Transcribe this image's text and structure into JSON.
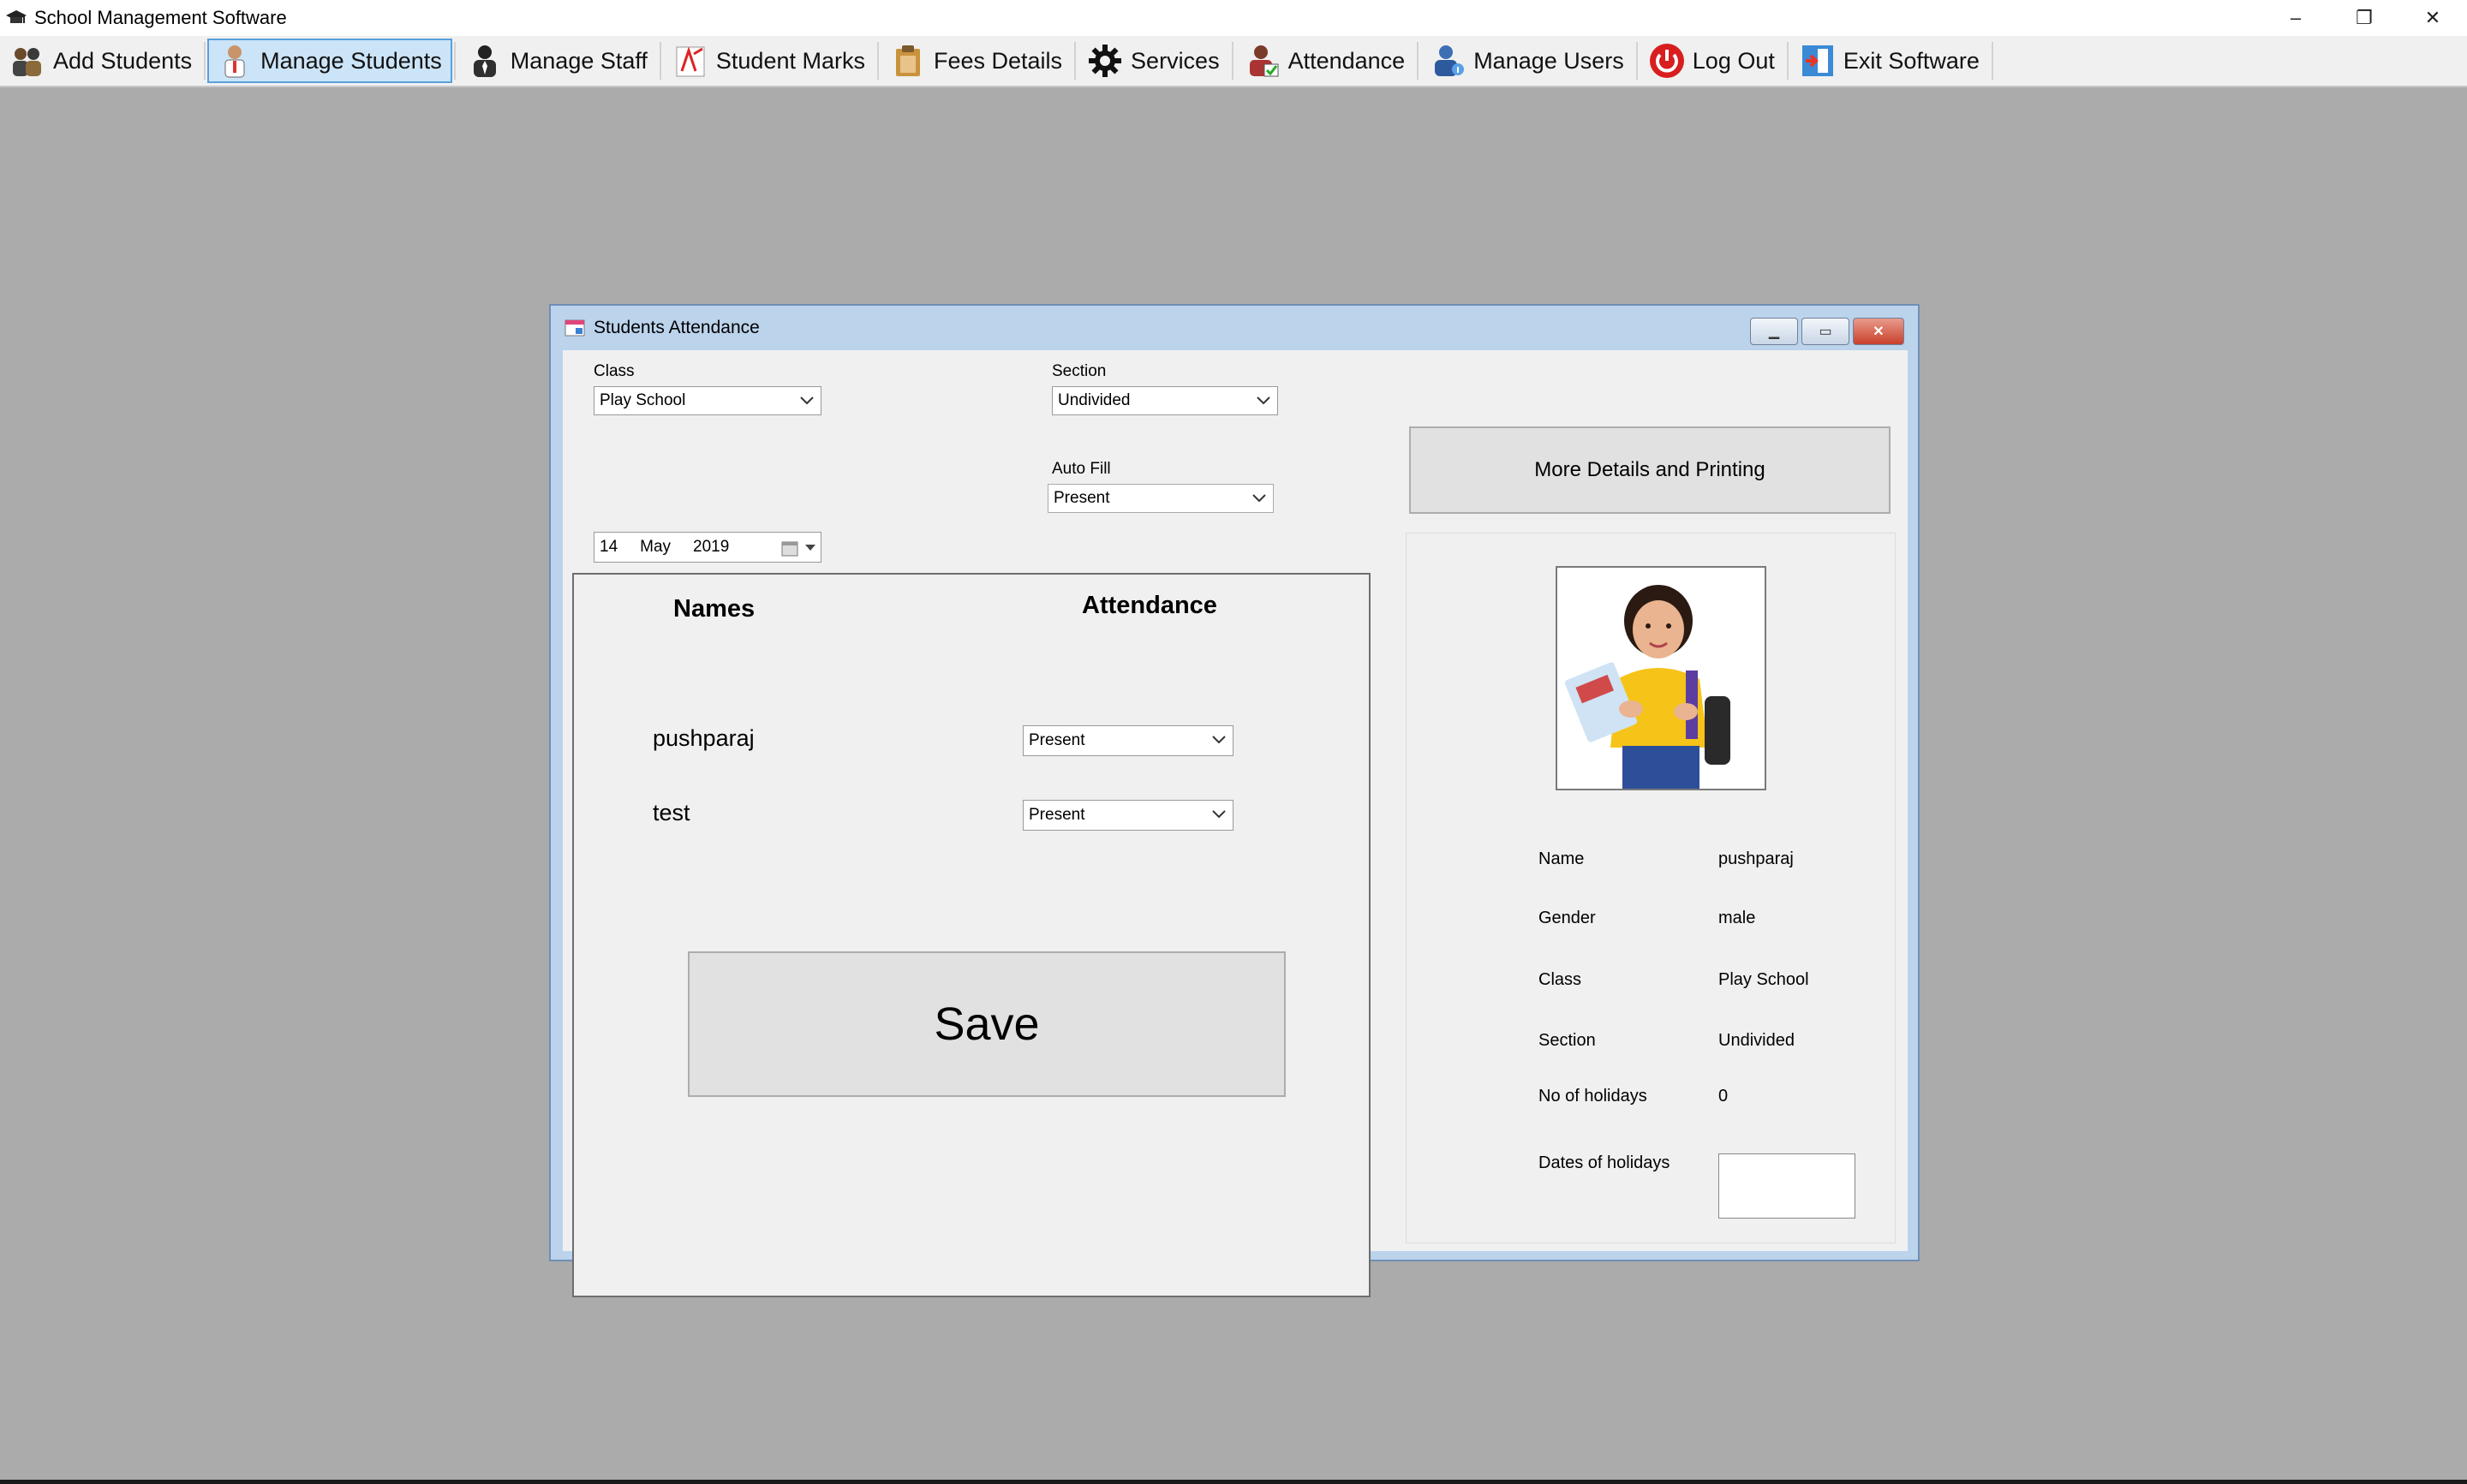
{
  "app": {
    "title": "School Management Software",
    "icon": "graduation-cap-icon"
  },
  "window_controls": {
    "minimize": "–",
    "restore": "❐",
    "close": "✕"
  },
  "menu": {
    "items": [
      {
        "label": "Add Students",
        "icon": "students-icon"
      },
      {
        "label": "Manage Students",
        "icon": "teacher-icon",
        "active": true
      },
      {
        "label": "Manage Staff",
        "icon": "staff-icon"
      },
      {
        "label": "Student Marks",
        "icon": "marks-icon"
      },
      {
        "label": "Fees Details",
        "icon": "clipboard-icon"
      },
      {
        "label": "Services",
        "icon": "gear-icon"
      },
      {
        "label": "Attendance",
        "icon": "attendance-icon"
      },
      {
        "label": "Manage Users",
        "icon": "user-icon"
      },
      {
        "label": "Log Out",
        "icon": "power-icon"
      },
      {
        "label": "Exit Software",
        "icon": "exit-icon"
      }
    ]
  },
  "child_window": {
    "title": "Students Attendance",
    "controls": {
      "minimize": "▁",
      "maximize": "▭",
      "close": "✕"
    }
  },
  "form": {
    "class_label": "Class",
    "class_value": "Play School",
    "section_label": "Section",
    "section_value": "Undivided",
    "date": {
      "day": "14",
      "month": "May",
      "year": "2019"
    },
    "autofill_label": "Auto Fill",
    "autofill_value": "Present",
    "more_button": "More Details and Printing"
  },
  "attendance": {
    "names_header": "Names",
    "attendance_header": "Attendance",
    "rows": [
      {
        "name": "pushparaj",
        "status": "Present"
      },
      {
        "name": "test",
        "status": "Present"
      }
    ],
    "save_label": "Save"
  },
  "details": {
    "name_label": "Name",
    "name_value": "pushparaj",
    "gender_label": "Gender",
    "gender_value": "male",
    "class_label": "Class",
    "class_value": "Play School",
    "section_label": "Section",
    "section_value": "Undivided",
    "holidays_label": "No of holidays",
    "holidays_value": "0",
    "holiday_dates_label": "Dates of holidays"
  },
  "colors": {
    "desktop": "#ababab",
    "active_menu": "#cce4f7",
    "child_frame": "#bcd3ec"
  }
}
